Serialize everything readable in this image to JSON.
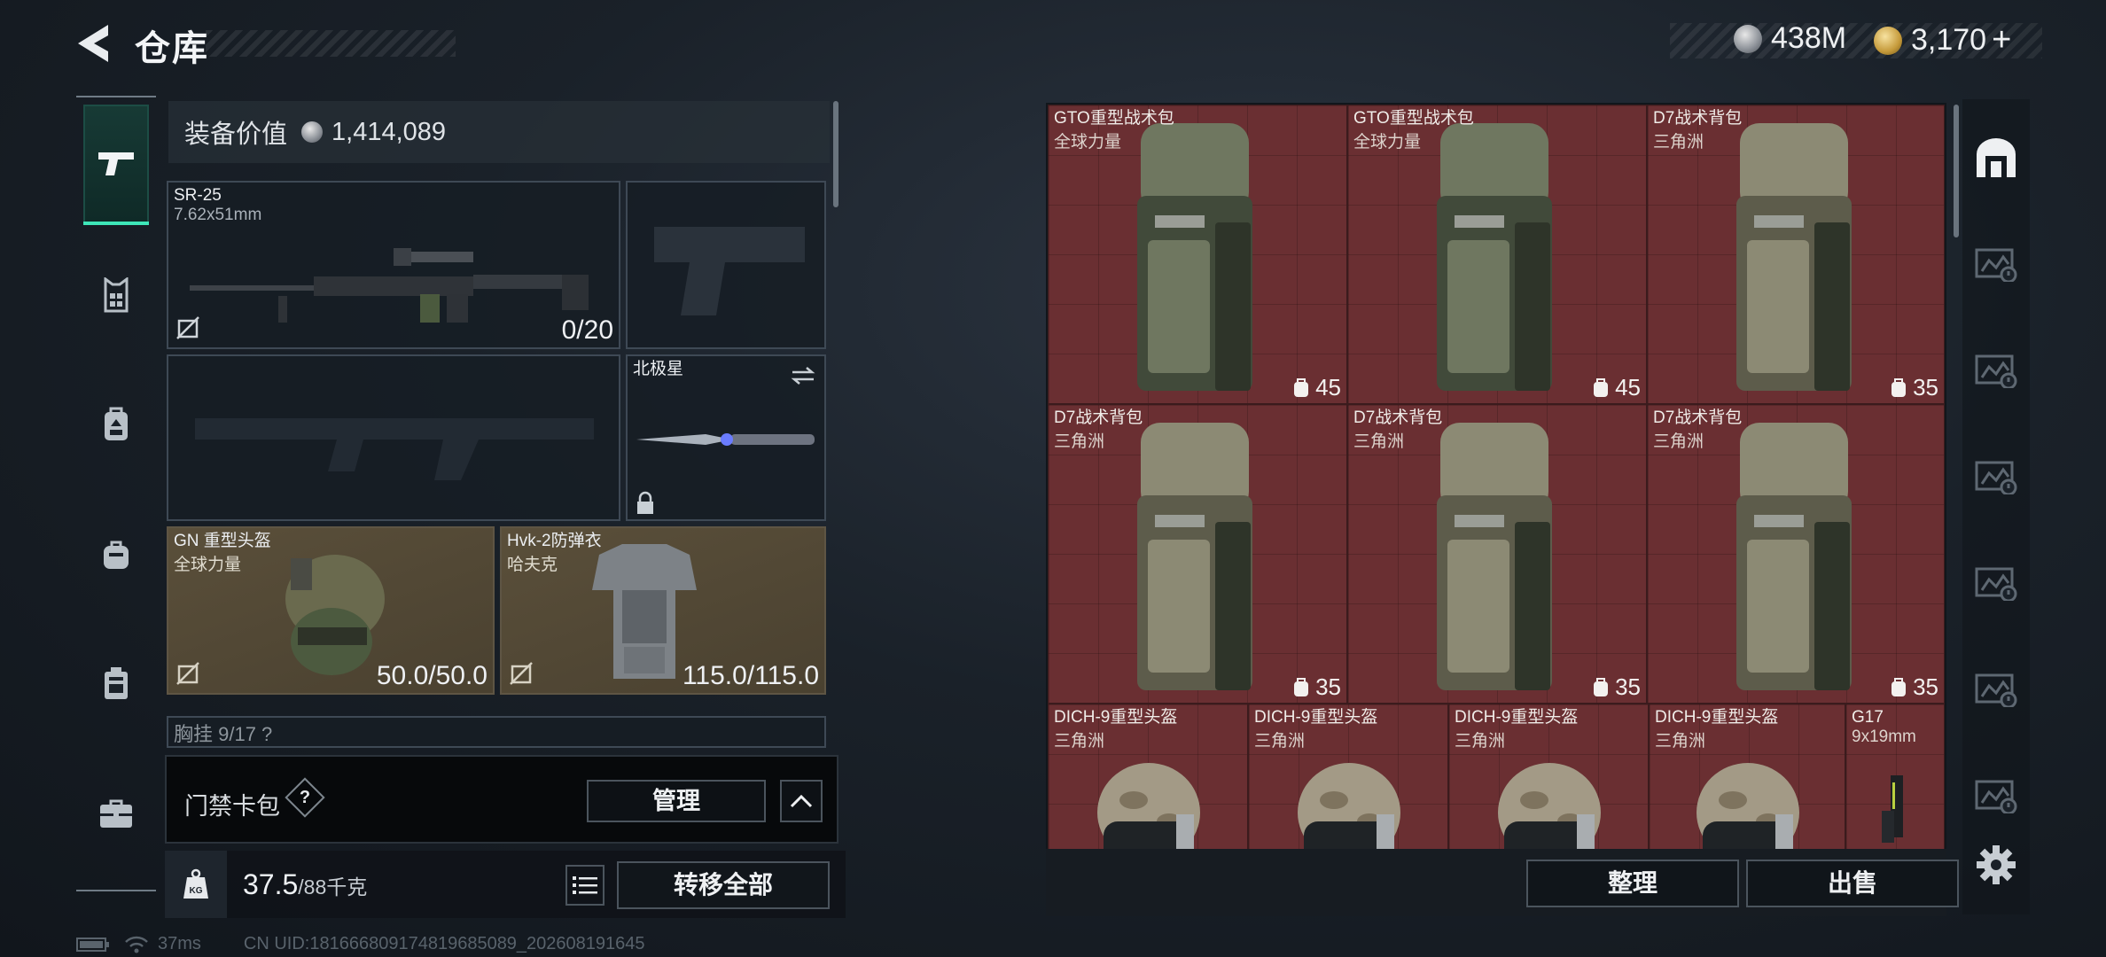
{
  "header": {
    "title": "仓库",
    "currency_silver": "438M",
    "currency_gold": "3,170",
    "gold_plus": "+"
  },
  "nav": {
    "items": [
      {
        "name": "weapons",
        "icon": "pistol-icon",
        "active": true
      },
      {
        "name": "armor",
        "icon": "vest-icon"
      },
      {
        "name": "backpack",
        "icon": "backpack-icon"
      },
      {
        "name": "supplies",
        "icon": "pouch-icon"
      },
      {
        "name": "containers",
        "icon": "case-icon"
      },
      {
        "name": "keys",
        "icon": "briefcase-icon"
      }
    ]
  },
  "loadout": {
    "equip_value_label": "装备价值",
    "equip_value": "1,414,089",
    "primary": {
      "name": "SR-25",
      "caliber": "7.62x51mm",
      "ammo": "0/20"
    },
    "melee": {
      "name": "北极星"
    },
    "helmet": {
      "name": "GN 重型头盔",
      "brand": "全球力量",
      "durability": "50.0/50.0"
    },
    "armor": {
      "name": "Hvk-2防弹衣",
      "brand": "哈夫克",
      "durability": "115.0/115.0"
    },
    "chest_rig_partial": "胸挂  9/17  ?"
  },
  "card_pack": {
    "label": "门禁卡包",
    "help": "?",
    "manage": "管理"
  },
  "weight": {
    "icon_label": "KG",
    "current": "37.5",
    "max": "/88千克",
    "transfer_all": "转移全部"
  },
  "status": {
    "ping": "37ms",
    "uid": "CN UID:18166680917481968508​9_202608191645"
  },
  "stash": {
    "items": [
      {
        "name": "GTO重型战术包",
        "brand": "全球力量",
        "capacity": "45",
        "kind": "backpack",
        "tone": "green"
      },
      {
        "name": "GTO重型战术包",
        "brand": "全球力量",
        "capacity": "45",
        "kind": "backpack",
        "tone": "green"
      },
      {
        "name": "D7战术背包",
        "brand": "三角洲",
        "capacity": "35",
        "kind": "backpack",
        "tone": "tan"
      },
      {
        "name": "D7战术背包",
        "brand": "三角洲",
        "capacity": "35",
        "kind": "backpack",
        "tone": "tan"
      },
      {
        "name": "D7战术背包",
        "brand": "三角洲",
        "capacity": "35",
        "kind": "backpack",
        "tone": "tan"
      },
      {
        "name": "D7战术背包",
        "brand": "三角洲",
        "capacity": "35",
        "kind": "backpack",
        "tone": "tan"
      },
      {
        "name": "DICH-9重型头盔",
        "brand": "三角洲",
        "kind": "helmet"
      },
      {
        "name": "DICH-9重型头盔",
        "brand": "三角洲",
        "kind": "helmet"
      },
      {
        "name": "DICH-9重型头盔",
        "brand": "三角洲",
        "kind": "helmet"
      },
      {
        "name": "DICH-9重型头盔",
        "brand": "三角洲",
        "kind": "helmet"
      },
      {
        "name": "G17",
        "brand": "9x19mm",
        "kind": "pistol"
      }
    ],
    "sort": "整理",
    "sell": "出售"
  },
  "colors": {
    "accent": "#3ee6b8",
    "stash_cell": "#6a2f32",
    "gold_slot": "#5a4f3a"
  }
}
